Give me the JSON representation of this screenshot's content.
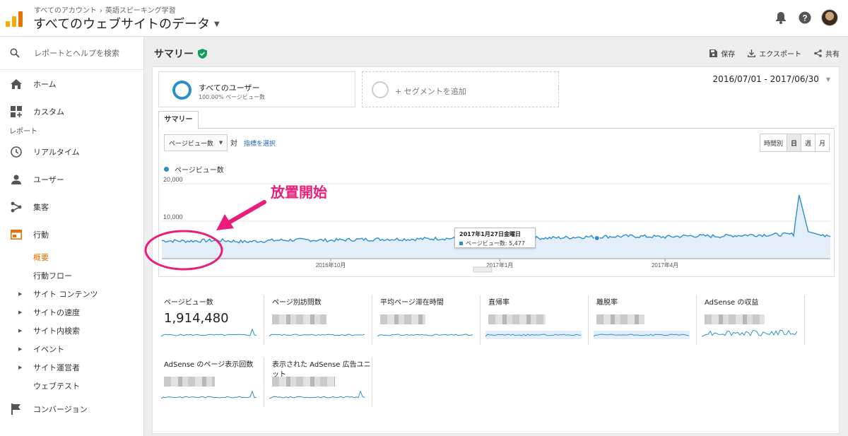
{
  "header": {
    "breadcrumb": [
      "すべてのアカウント",
      "›",
      "英語スピーキング学習"
    ],
    "view_title": "すべてのウェブサイトのデータ",
    "icons": [
      "bell-icon",
      "help-icon",
      "avatar"
    ]
  },
  "sidebar": {
    "search_placeholder": "レポートとヘルプを検索",
    "home": "ホーム",
    "custom": "カスタム",
    "reports_section": "レポート",
    "realtime": "リアルタイム",
    "users": "ユーザー",
    "acquisition": "集客",
    "behavior": "行動",
    "behavior_sub": {
      "overview": "概要",
      "flow": "行動フロー",
      "site_content": "サイト コンテンツ",
      "site_speed": "サイトの速度",
      "site_search": "サイト内検索",
      "events": "イベント",
      "publisher": "サイト運営者",
      "experiments": "ウェブテスト"
    },
    "conversions": "コンバージョン"
  },
  "main": {
    "title": "サマリー",
    "actions": {
      "save": "保存",
      "export": "エクスポート",
      "share": "共有"
    },
    "segment": {
      "title": "すべてのユーザー",
      "subtitle": "100.00% ページビュー数"
    },
    "add_segment": "+ セグメントを追加",
    "date_range": "2016/07/01 - 2017/06/30",
    "tab": "サマリー",
    "metric_select": "ページビュー数",
    "vs": "対",
    "select_metric": "指標を選択",
    "granularity": [
      "時間別",
      "日",
      "週",
      "月"
    ],
    "granularity_selected": "日",
    "legend": "ページビュー数",
    "tooltip": {
      "date": "2017年1月27日金曜日",
      "label": "ページビュー数: 5,477"
    },
    "annotation": "放置開始"
  },
  "chart_data": {
    "type": "area",
    "series": [
      {
        "name": "ページビュー数",
        "color": "#2b8fce"
      }
    ],
    "x_range": [
      "2016/07/01",
      "2017/06/30"
    ],
    "x_ticks": [
      "2016年10月",
      "2017年1月",
      "2017年4月"
    ],
    "y_ticks": [
      "10,000",
      "20,000"
    ],
    "ylim": [
      0,
      20000
    ],
    "points": [
      [
        "2016-07-01",
        4800
      ],
      [
        "2016-07-15",
        4700
      ],
      [
        "2016-08-01",
        4900
      ],
      [
        "2016-08-15",
        4500
      ],
      [
        "2016-09-01",
        4900
      ],
      [
        "2016-09-15",
        5000
      ],
      [
        "2016-10-01",
        4900
      ],
      [
        "2016-10-15",
        5100
      ],
      [
        "2016-11-01",
        5200
      ],
      [
        "2016-11-15",
        5200
      ],
      [
        "2016-12-01",
        5400
      ],
      [
        "2016-12-15",
        5300
      ],
      [
        "2017-01-01",
        5500
      ],
      [
        "2017-01-15",
        5600
      ],
      [
        "2017-01-27",
        5477
      ],
      [
        "2017-02-15",
        5800
      ],
      [
        "2017-03-01",
        5900
      ],
      [
        "2017-03-15",
        6000
      ],
      [
        "2017-04-01",
        5800
      ],
      [
        "2017-04-15",
        6100
      ],
      [
        "2017-05-01",
        6000
      ],
      [
        "2017-05-15",
        6300
      ],
      [
        "2017-06-01",
        6400
      ],
      [
        "2017-06-10",
        6500
      ],
      [
        "2017-06-13",
        17000
      ],
      [
        "2017-06-18",
        7200
      ],
      [
        "2017-06-24",
        6400
      ],
      [
        "2017-06-30",
        6100
      ]
    ],
    "highlighted_point": {
      "date": "2017-01-27",
      "value": 5477
    }
  },
  "scorecards": [
    {
      "title": "ページビュー数",
      "value": "1,914,480"
    },
    {
      "title": "ページ別訪問数",
      "value": ""
    },
    {
      "title": "平均ページ滞在時間",
      "value": ""
    },
    {
      "title": "直帰率",
      "value": ""
    },
    {
      "title": "離脱率",
      "value": ""
    },
    {
      "title": "AdSense の収益",
      "value": ""
    },
    {
      "title": "AdSense のページ表示回数",
      "value": ""
    },
    {
      "title": "表示された AdSense 広告ユニット",
      "value": ""
    }
  ],
  "colors": {
    "accent": "#2b8fce",
    "active_nav": "#e8710a",
    "annotation": "#e91e7a",
    "link": "#1a64b8"
  }
}
